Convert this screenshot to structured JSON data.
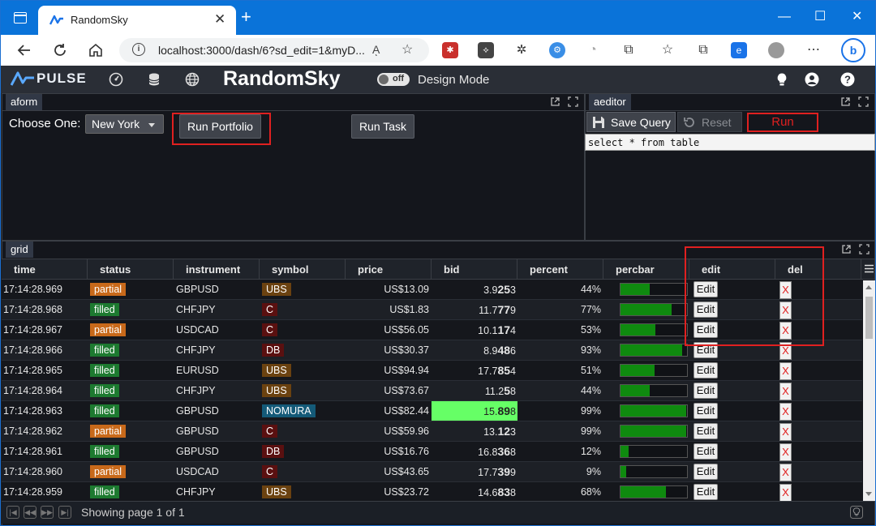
{
  "browser": {
    "tab_title": "RandomSky",
    "tab_close": "✕",
    "new_tab": "+",
    "url": "localhost:3000/dash/6?sd_edit=1&myD...",
    "read_aloud": "Aͅ",
    "win_min": "—",
    "win_max": "☐",
    "win_close": "✕"
  },
  "app": {
    "logo_text": "PULSE",
    "name": "RandomSky",
    "toggle": "off",
    "design_mode": "Design Mode"
  },
  "aform": {
    "tab": "aform",
    "choose_label": "Choose One:",
    "select_value": "New York",
    "run_portfolio": "Run Portfolio",
    "run_task": "Run Task"
  },
  "aeditor": {
    "tab": "aeditor",
    "save_query": "Save Query",
    "reset": "Reset",
    "run": "Run",
    "sql": "select * from table"
  },
  "grid": {
    "tab": "grid",
    "columns": [
      "time",
      "status",
      "instrument",
      "symbol",
      "price",
      "bid",
      "percent",
      "percbar",
      "edit",
      "del"
    ],
    "edit_label": "Edit",
    "del_label": "X",
    "rows": [
      {
        "time": "17:14:28.969",
        "status": "partial",
        "instrument": "GBPUSD",
        "symbol": "UBS",
        "price": "US$13.09",
        "bid_a": "3.9",
        "bid_b": "25",
        "bid_c": "3",
        "percent": "44%",
        "perc": 44
      },
      {
        "time": "17:14:28.968",
        "status": "filled",
        "instrument": "CHFJPY",
        "symbol": "C",
        "price": "US$1.83",
        "bid_a": "11.7",
        "bid_b": "77",
        "bid_c": "9",
        "percent": "77%",
        "perc": 77
      },
      {
        "time": "17:14:28.967",
        "status": "partial",
        "instrument": "USDCAD",
        "symbol": "C",
        "price": "US$56.05",
        "bid_a": "10.1",
        "bid_b": "17",
        "bid_c": "4",
        "percent": "53%",
        "perc": 53
      },
      {
        "time": "17:14:28.966",
        "status": "filled",
        "instrument": "CHFJPY",
        "symbol": "DB",
        "price": "US$30.37",
        "bid_a": "8.9",
        "bid_b": "48",
        "bid_c": "6",
        "percent": "93%",
        "perc": 93
      },
      {
        "time": "17:14:28.965",
        "status": "filled",
        "instrument": "EURUSD",
        "symbol": "UBS",
        "price": "US$94.94",
        "bid_a": "17.7",
        "bid_b": "85",
        "bid_c": "4",
        "percent": "51%",
        "perc": 51
      },
      {
        "time": "17:14:28.964",
        "status": "filled",
        "instrument": "CHFJPY",
        "symbol": "UBS",
        "price": "US$73.67",
        "bid_a": "11.2",
        "bid_b": "5",
        "bid_c": "8",
        "percent": "44%",
        "perc": 44
      },
      {
        "time": "17:14:28.963",
        "status": "filled",
        "instrument": "GBPUSD",
        "symbol": "NOMURA",
        "price": "US$82.44",
        "bid_a": "15.",
        "bid_b": "89",
        "bid_c": "8",
        "percent": "99%",
        "perc": 99,
        "bid_highlight": true
      },
      {
        "time": "17:14:28.962",
        "status": "partial",
        "instrument": "GBPUSD",
        "symbol": "C",
        "price": "US$59.96",
        "bid_a": "13.",
        "bid_b": "12",
        "bid_c": "3",
        "percent": "99%",
        "perc": 99
      },
      {
        "time": "17:14:28.961",
        "status": "filled",
        "instrument": "GBPUSD",
        "symbol": "DB",
        "price": "US$16.76",
        "bid_a": "16.8",
        "bid_b": "36",
        "bid_c": "8",
        "percent": "12%",
        "perc": 12
      },
      {
        "time": "17:14:28.960",
        "status": "partial",
        "instrument": "USDCAD",
        "symbol": "C",
        "price": "US$43.65",
        "bid_a": "17.7",
        "bid_b": "39",
        "bid_c": "9",
        "percent": "9%",
        "perc": 9
      },
      {
        "time": "17:14:28.959",
        "status": "filled",
        "instrument": "CHFJPY",
        "symbol": "UBS",
        "price": "US$23.72",
        "bid_a": "14.6",
        "bid_b": "83",
        "bid_c": "8",
        "percent": "68%",
        "perc": 68
      }
    ],
    "pager_text": "Showing page 1 of 1"
  },
  "colors": {
    "browser_blue": "#0a73d9",
    "partial": "#c8691a",
    "filled": "#1d7a30",
    "percbar": "#0f8a0f",
    "highlight_red": "#e02020",
    "bid_highlight": "#66ff66"
  },
  "icons": [
    "back-arrow-icon",
    "refresh-icon",
    "home-icon",
    "info-icon",
    "favorites-add-icon",
    "extension-icon",
    "favorites-icon",
    "collections-icon",
    "profile-icon",
    "more-icon",
    "bing-icon",
    "dashboard-icon",
    "database-icon",
    "globe-icon",
    "lightbulb-icon",
    "user-icon",
    "help-icon",
    "popout-icon",
    "maximize-icon",
    "floppy-icon",
    "reset-icon",
    "hamburger-icon"
  ]
}
